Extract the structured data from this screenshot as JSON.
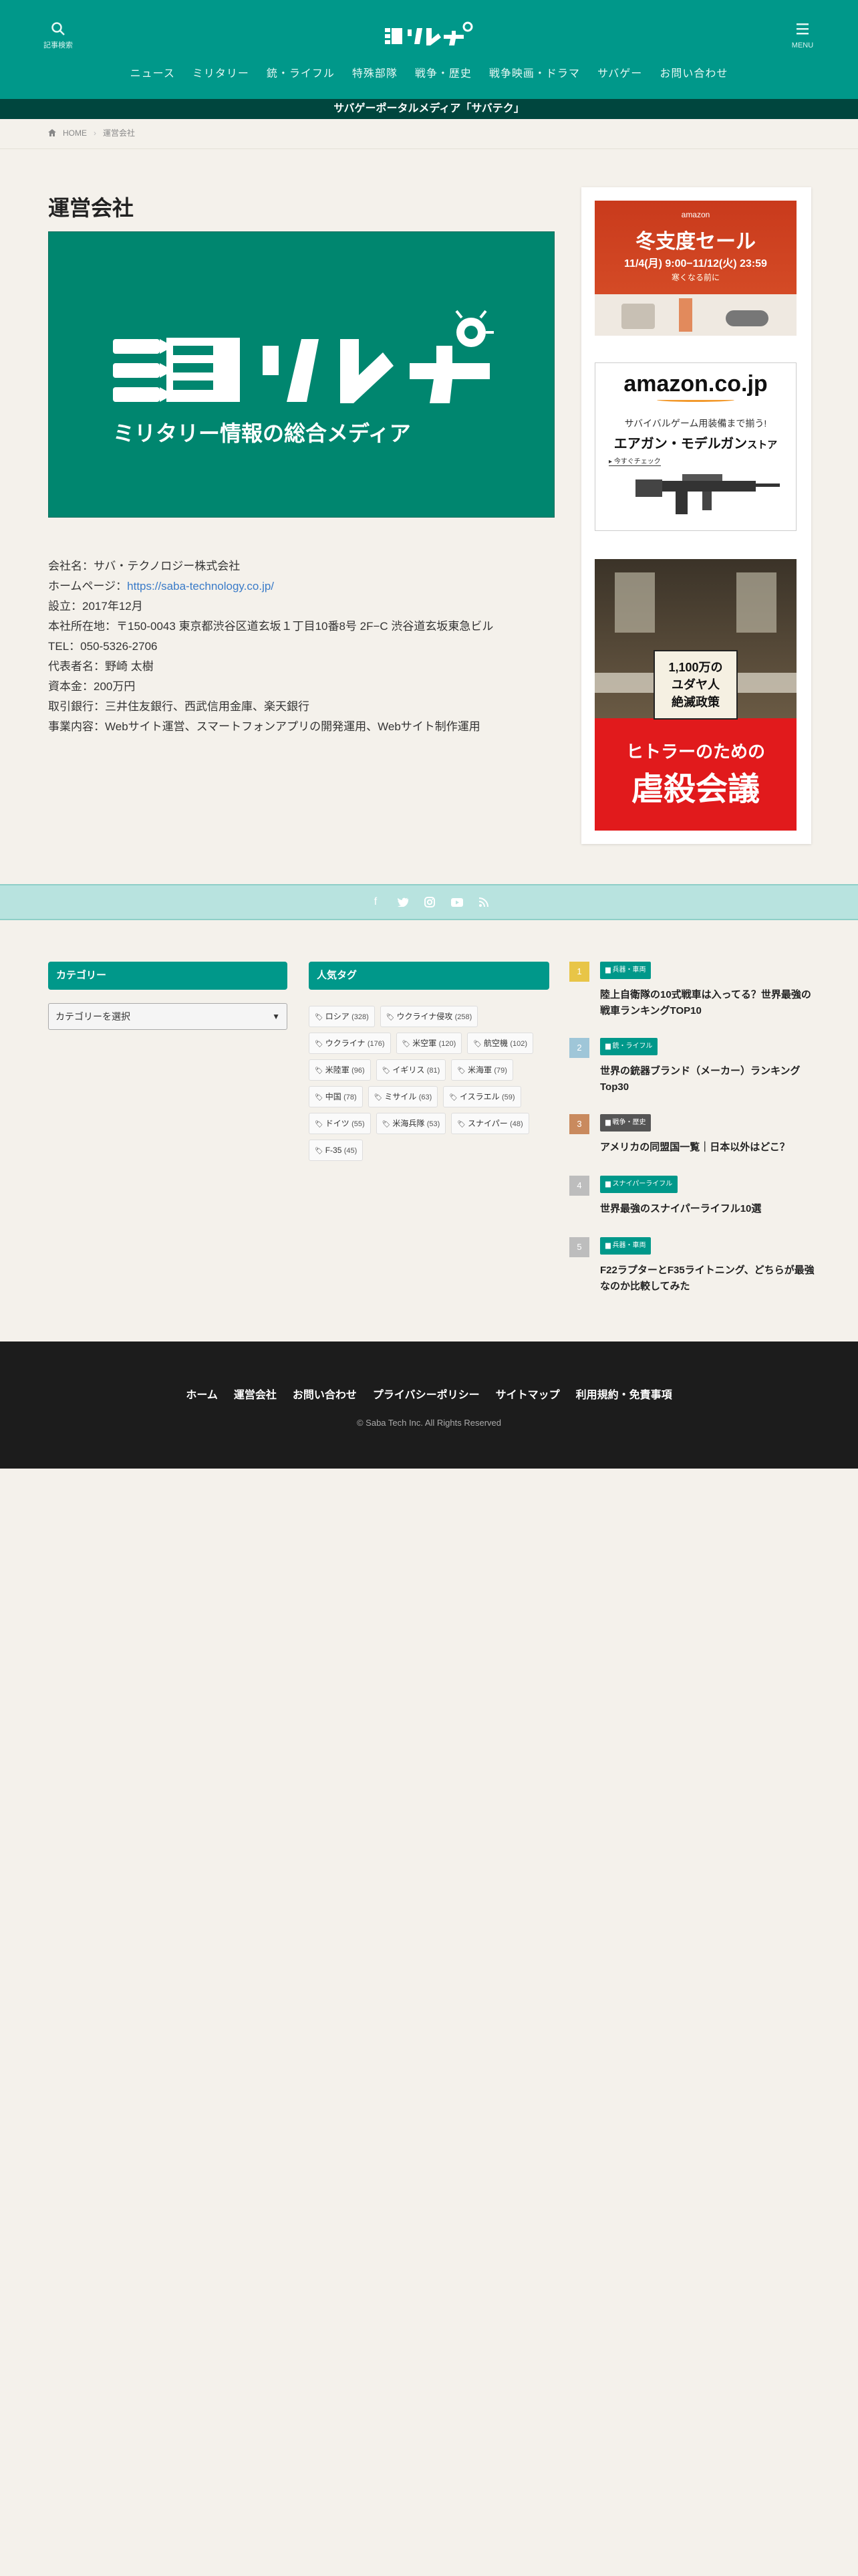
{
  "header": {
    "search_label": "記事検索",
    "menu_label": "MENU",
    "logo_text": "ミリレポ",
    "nav": [
      "ニュース",
      "ミリタリー",
      "銃・ライフル",
      "特殊部隊",
      "戦争・歴史",
      "戦争映画・ドラマ",
      "サバゲー",
      "お問い合わせ"
    ],
    "topbar": "サバゲーポータルメディア「サバテク」"
  },
  "breadcrumb": {
    "home": "HOME",
    "current": "運営会社"
  },
  "main": {
    "title": "運営会社",
    "hero_logo": "ミリレポ",
    "hero_tagline": "ミリタリー情報の総合メディア",
    "company": {
      "name": "会社名：サバ・テクノロジー株式会社",
      "homepage_label": "ホームページ：",
      "homepage_url": "https://saba-technology.co.jp/",
      "founded": "設立：2017年12月",
      "address": "本社所在地：〒150-0043 東京都渋谷区道玄坂１丁目10番8号 2F−C 渋谷道玄坂東急ビル",
      "tel": "TEL：050-5326-2706",
      "ceo": "代表者名：野崎 太樹",
      "capital": "資本金：200万円",
      "banks": "取引銀行：三井住友銀行、西武信用金庫、楽天銀行",
      "business": "事業内容：Webサイト運営、スマートフォンアプリの開発運用、Webサイト制作運用"
    }
  },
  "sidebar": {
    "ad1": {
      "brand": "amazon",
      "title": "冬支度セール",
      "dates": "11/4(月) 9:00−11/12(火) 23:59",
      "sub": "寒くなる前に"
    },
    "ad2": {
      "brand": "amazon.co.jp",
      "line1": "サバイバルゲーム用装備まで揃う!",
      "line2": "エアガン・モデルガン",
      "line2b": "ストア",
      "cta": "今すぐチェック"
    },
    "ad3": {
      "tag": "1,100万の",
      "tag2": "ユダヤ人",
      "tag3": "絶滅政策",
      "title1": "ヒトラーのための",
      "title2": "虐殺会議"
    }
  },
  "social": {
    "icons": [
      "facebook-icon",
      "twitter-icon",
      "instagram-icon",
      "youtube-icon",
      "rss-icon"
    ]
  },
  "widgets": {
    "category": {
      "heading": "カテゴリー",
      "select_placeholder": "カテゴリーを選択"
    },
    "tags": {
      "heading": "人気タグ",
      "items": [
        {
          "name": "ロシア",
          "count": "(328)"
        },
        {
          "name": "ウクライナ侵攻",
          "count": "(258)"
        },
        {
          "name": "ウクライナ",
          "count": "(176)"
        },
        {
          "name": "米空軍",
          "count": "(120)"
        },
        {
          "name": "航空機",
          "count": "(102)"
        },
        {
          "name": "米陸軍",
          "count": "(96)"
        },
        {
          "name": "イギリス",
          "count": "(81)"
        },
        {
          "name": "米海軍",
          "count": "(79)"
        },
        {
          "name": "中国",
          "count": "(78)"
        },
        {
          "name": "ミサイル",
          "count": "(63)"
        },
        {
          "name": "イスラエル",
          "count": "(59)"
        },
        {
          "name": "ドイツ",
          "count": "(55)"
        },
        {
          "name": "米海兵隊",
          "count": "(53)"
        },
        {
          "name": "スナイパー",
          "count": "(48)"
        },
        {
          "name": "F-35",
          "count": "(45)"
        }
      ]
    },
    "ranking": [
      {
        "num": "1",
        "cat": "兵器・車両",
        "title": "陸上自衛隊の10式戦車は入ってる？世界最強の戦車ランキングTOP10",
        "color": "#e8c547"
      },
      {
        "num": "2",
        "cat": "銃・ライフル",
        "title": "世界の銃器ブランド（メーカー）ランキングTop30",
        "color": "#9fc6d8"
      },
      {
        "num": "3",
        "cat": "戦争・歴史",
        "title": "アメリカの同盟国一覧｜日本以外はどこ？",
        "color": "#c98a5e"
      },
      {
        "num": "4",
        "cat": "スナイパーライフル",
        "title": "世界最強のスナイパーライフル10選",
        "color": "#bdbdbd"
      },
      {
        "num": "5",
        "cat": "兵器・車両",
        "title": "F22ラプターとF35ライトニング、どちらが最強なのか比較してみた",
        "color": "#bdbdbd"
      }
    ]
  },
  "footer": {
    "links": [
      "ホーム",
      "運営会社",
      "お問い合わせ",
      "プライバシーポリシー",
      "サイトマップ",
      "利用規約・免責事項"
    ],
    "copyright": "© Saba Tech Inc. All Rights Reserved"
  },
  "colors": {
    "brand": "#00988a",
    "topbar": "#00463e",
    "footer": "#1c1c1c",
    "link": "#3a7bc8"
  }
}
